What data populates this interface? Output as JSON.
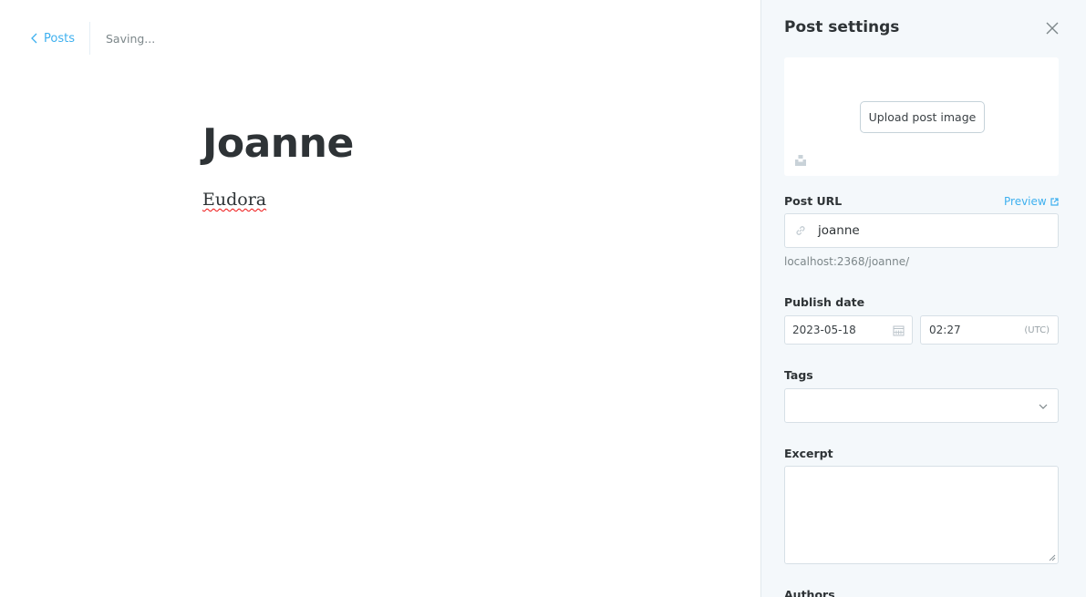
{
  "editor": {
    "back_label": "Posts",
    "status": "Saving...",
    "title": "Joanne",
    "body": "Eudora"
  },
  "settings": {
    "title": "Post settings",
    "upload_label": "Upload post image",
    "post_url_label": "Post URL",
    "preview_label": "Preview",
    "slug": "joanne",
    "url_hint": "localhost:2368/joanne/",
    "publish_date_label": "Publish date",
    "date": "2023-05-18",
    "time": "02:27",
    "timezone": "(UTC)",
    "tags_label": "Tags",
    "excerpt_label": "Excerpt",
    "authors_label": "Authors"
  },
  "icons": {
    "back": "chevron-left-icon",
    "close": "close-icon",
    "unsplash": "unsplash-icon",
    "preview": "external-link-icon",
    "link": "link-icon",
    "calendar": "calendar-icon",
    "dropdown": "chevron-down-icon"
  },
  "colors": {
    "accent": "#3eb0ef",
    "sidebar_bg": "#f4f8fb",
    "text_dark": "#2e3336",
    "muted": "#7d878a"
  }
}
